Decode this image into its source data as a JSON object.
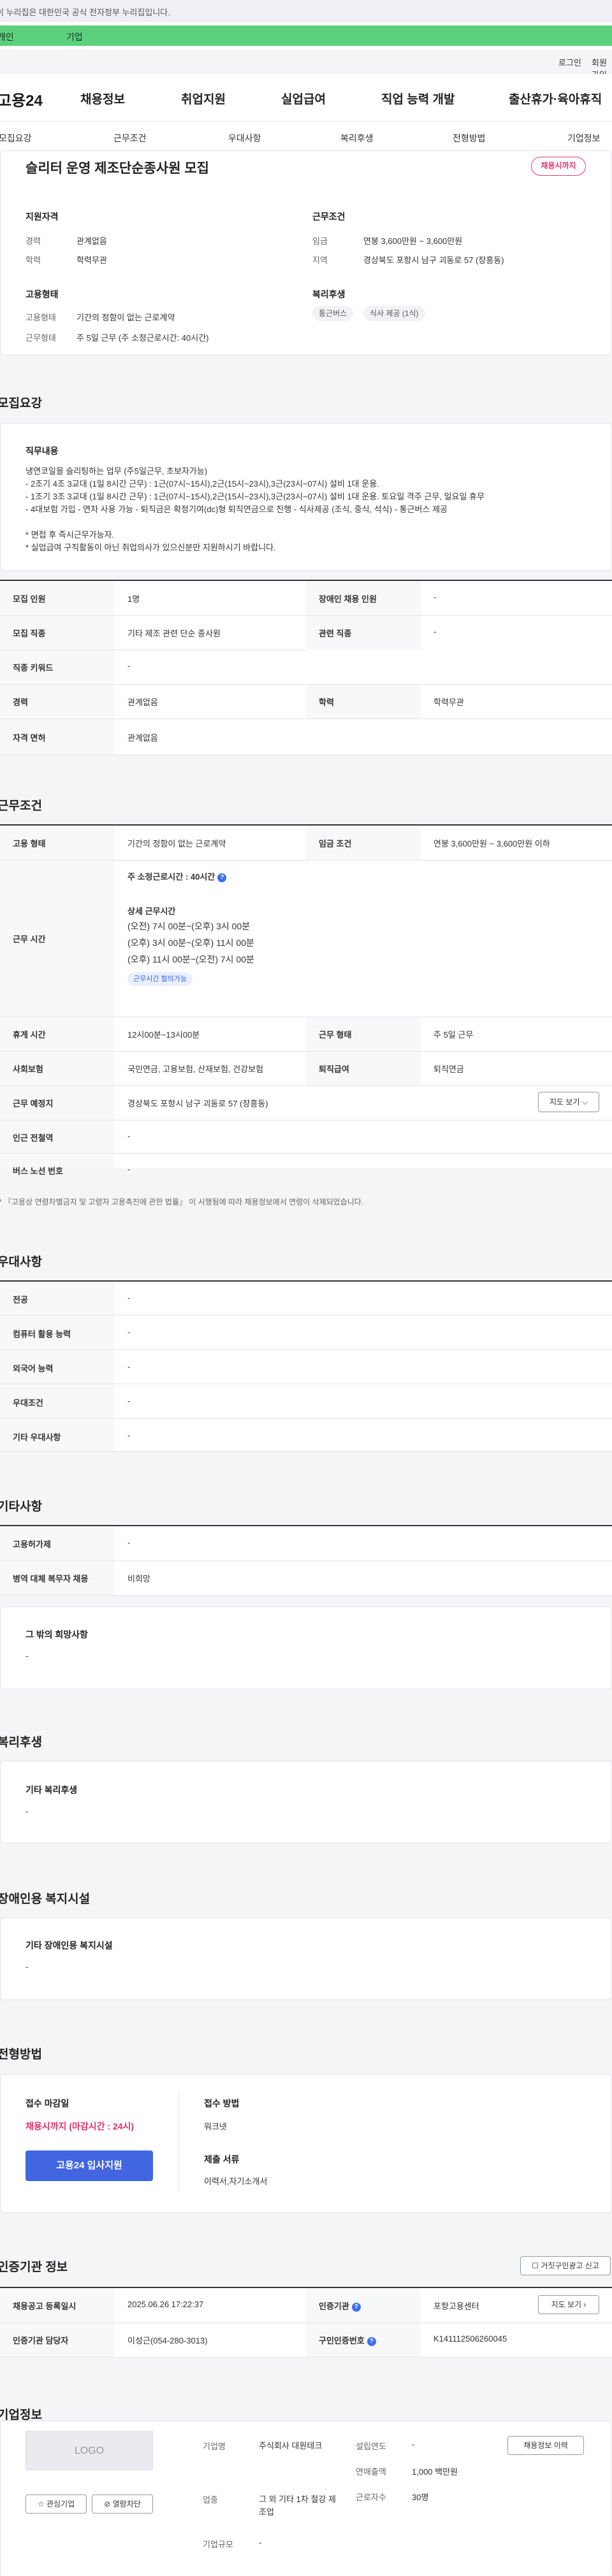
{
  "gov_banner": "이 누리집은 대한민국 공식 전자정부 누리집입니다.",
  "login_strip": {
    "left": "개인",
    "right": "기업"
  },
  "util": {
    "login": "로그인",
    "join": "회원가입"
  },
  "gnb": {
    "logo": "고용24",
    "items": [
      "채용정보",
      "취업지원",
      "실업급여",
      "직업 능력 개발",
      "출산휴가·육아휴직"
    ]
  },
  "subnav": [
    "모집요강",
    "근무조건",
    "우대사항",
    "복리후생",
    "전형방법",
    "기업정보"
  ],
  "summary": {
    "title": "슬리터 운영 제조단순종사원 모집",
    "status_badge": "채용시까지",
    "qual_title": "지원자격",
    "career_label": "경력",
    "career": "관계없음",
    "edu_label": "학력",
    "edu": "학력무관",
    "cond_title": "근무조건",
    "pay_label": "임금",
    "pay": "연봉 3,600만원 ~ 3,600만원",
    "region_label": "지역",
    "region": "경상북도 포항시 남구 괴동로 57 (장흥동)",
    "emp_title": "고용형태",
    "emp_label": "고용형태",
    "emp": "기간의 정함이 없는 근로계약",
    "work_label": "근무형태",
    "work": "주 5일 근무 (주 소정근로시간: 40시간)",
    "welfare_title": "복리후생",
    "welfare_chips": [
      "통근버스",
      "식사 제공 (1식)"
    ]
  },
  "recruit": {
    "section_title": "모집요강",
    "job_title": "직무내용",
    "job_lines": [
      "냉연코일을 슬리팅하는 업무 (주5일근무, 초보자가능)",
      "- 2조기 4조 3교대 (1일 8시간 근무) : 1근(07시~15시),2근(15시~23시),3근(23시~07시) 설비 1대 운용.",
      "- 1조기 3조 3교대 (1일 8시간 근무) : 1근(07시~15시),2근(15시~23시),3근(23시~07시) 설비 1대 운용.  토요일 격주 근무, 일요일 휴무",
      "- 4대보험 가입  - 연차 사용 가능  - 퇴직금은 확정기여(dc)형 퇴직연금으로 진행  - 식사제공 (조식, 중식, 석식)  - 통근버스 제공",
      "",
      "* 면접 후  즉시근무가능자.",
      "* 실업급여 구직활동이 아닌  취업의사가 있으신분만 지원하시기 바랍니다."
    ],
    "rows": [
      {
        "l1": "모집 인원",
        "v1": "1명",
        "l2": "장애인 채용 인원",
        "v2": "-"
      },
      {
        "l1": "모집 직종",
        "v1": "기타 제조 관련 단순 종사원",
        "l2": "관련 직종",
        "v2": "-"
      },
      {
        "l1": "직종 키워드",
        "v1": "-",
        "l2": "",
        "v2": ""
      },
      {
        "l1": "경력",
        "v1": "관계없음",
        "l2": "학력",
        "v2": "학력무관"
      },
      {
        "l1": "자격 면허",
        "v1": "관계없음",
        "l2": "",
        "v2": ""
      }
    ]
  },
  "conditions": {
    "section_title": "근무조건",
    "emp_label": "고용 형태",
    "emp": "기간의 정함이 없는 근로계약",
    "pay_label": "임금 조건",
    "pay": "연봉 3,600만원 ~ 3,600만원 이하",
    "hours_label": "근무 시간",
    "hours_main": "주 소정근로시간 : 40시간",
    "hours_detail_title": "상세 근무시간",
    "hours_lines": [
      "(오전) 7시 00분~(오후) 3시 00분",
      "(오후) 3시 00분~(오후) 11시 00분",
      "(오후) 11시 00분~(오전) 7시 00분"
    ],
    "hours_chip": "근무시간 협의가능",
    "rest_label": "휴게 시간",
    "rest": "12시00분~13시00분",
    "form_label": "근무 형태",
    "form": "주 5일 근무",
    "ins_label": "사회보험",
    "ins": "국민연금, 고용보험, 산재보험, 건강보험",
    "sev_label": "퇴직급여",
    "sev": "퇴직연금",
    "place_label": "근무 예정지",
    "place": "경상북도 포항시 남구 괴동로 57 (장흥동)",
    "map_btn": "지도 보기",
    "subway_label": "인근 전철역",
    "subway": "-",
    "bus_label": "버스 노선 번호",
    "bus": "-",
    "note": "* 『고용상 연령차별금지 및 고령자 고용촉진에 관한 법률』 이 시행됨에 따라 채용정보에서 연령이 삭제되었습니다."
  },
  "preferred": {
    "section_title": "우대사항",
    "rows": [
      {
        "l": "전공",
        "v": "-"
      },
      {
        "l": "컴퓨터 활용 능력",
        "v": "-"
      },
      {
        "l": "외국어 능력",
        "v": "-"
      },
      {
        "l": "우대조건",
        "v": "-"
      },
      {
        "l": "기타 우대사항",
        "v": "-"
      }
    ]
  },
  "etc": {
    "section_title": "기타사항",
    "rows": [
      {
        "l": "고용허가제",
        "v": "-"
      },
      {
        "l": "병역 대체 복무자 채용",
        "v": "비희망"
      }
    ],
    "box_title": "그 밖의 희망사항",
    "box_value": "-"
  },
  "welfare": {
    "section_title": "복리후생",
    "box_title": "기타 복리후생",
    "box_value": "-"
  },
  "disability": {
    "section_title": "장애인용 복지시설",
    "box_title": "기타 장애인용 복지시설",
    "box_value": "-"
  },
  "process": {
    "section_title": "전형방법",
    "deadline_label": "접수 마감일",
    "deadline": "채용시까지 (마감시간 : 24시)",
    "apply_btn": "고용24 입사지원",
    "method_label": "접수 방법",
    "method": "워크넷",
    "docs_label": "제출 서류",
    "docs": "이력서,자기소개서"
  },
  "cert": {
    "section_title": "인증기관 정보",
    "report_btn": "거짓구인광고 신고",
    "reg_label": "채용공고 등록일시",
    "reg": "2025.06.26 17:22:37",
    "org_label": "인증기관",
    "org": "포항고용센터",
    "map_btn": "지도 보기",
    "staff_label": "인증기관 담당자",
    "staff": "이성근(054-280-3013)",
    "num_label": "구인인증번호",
    "num": "K141112506260045"
  },
  "company": {
    "section_title": "기업정보",
    "logo_text": "LOGO",
    "fav_btn": "관심기업",
    "block_btn": "열람차단",
    "name_label": "기업명",
    "name": "주식회사 대원테크",
    "industry_label": "업종",
    "industry": "그 외 기타 1차 철강 제조업",
    "size_label": "기업규모",
    "size": "-",
    "founded_label": "설립연도",
    "founded": "-",
    "sales_label": "연매출액",
    "sales": "1,000 백만원",
    "workers_label": "근로자수",
    "workers": "30명",
    "history_btn": "채용정보 이력"
  }
}
